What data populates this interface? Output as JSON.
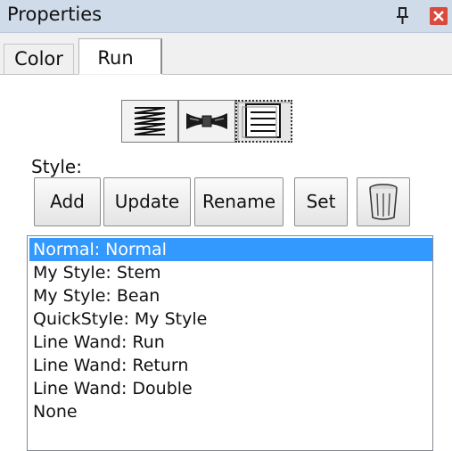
{
  "window": {
    "title": "Properties",
    "colors": {
      "titlebar": "#cfdbe9",
      "close": "#d94a3d",
      "selection": "#3399ff"
    }
  },
  "tabs": [
    {
      "label": "Color",
      "active": false
    },
    {
      "label": "Run",
      "active": true
    }
  ],
  "mode_buttons": [
    {
      "icon": "zigzag-lines-icon",
      "active": false
    },
    {
      "icon": "bowtie-icon",
      "active": false
    },
    {
      "icon": "document-lines-icon",
      "active": true
    }
  ],
  "style": {
    "label": "Style:",
    "buttons": {
      "add": "Add",
      "update": "Update",
      "rename": "Rename",
      "set": "Set",
      "delete_icon": "trash-can-icon"
    },
    "items": [
      {
        "text": "Normal: Normal",
        "selected": true
      },
      {
        "text": "My Style: Stem",
        "selected": false
      },
      {
        "text": "My Style: Bean",
        "selected": false
      },
      {
        "text": "QuickStyle: My Style",
        "selected": false
      },
      {
        "text": "Line Wand: Run",
        "selected": false
      },
      {
        "text": "Line Wand: Return",
        "selected": false
      },
      {
        "text": "Line Wand: Double",
        "selected": false
      },
      {
        "text": "None",
        "selected": false
      }
    ]
  }
}
